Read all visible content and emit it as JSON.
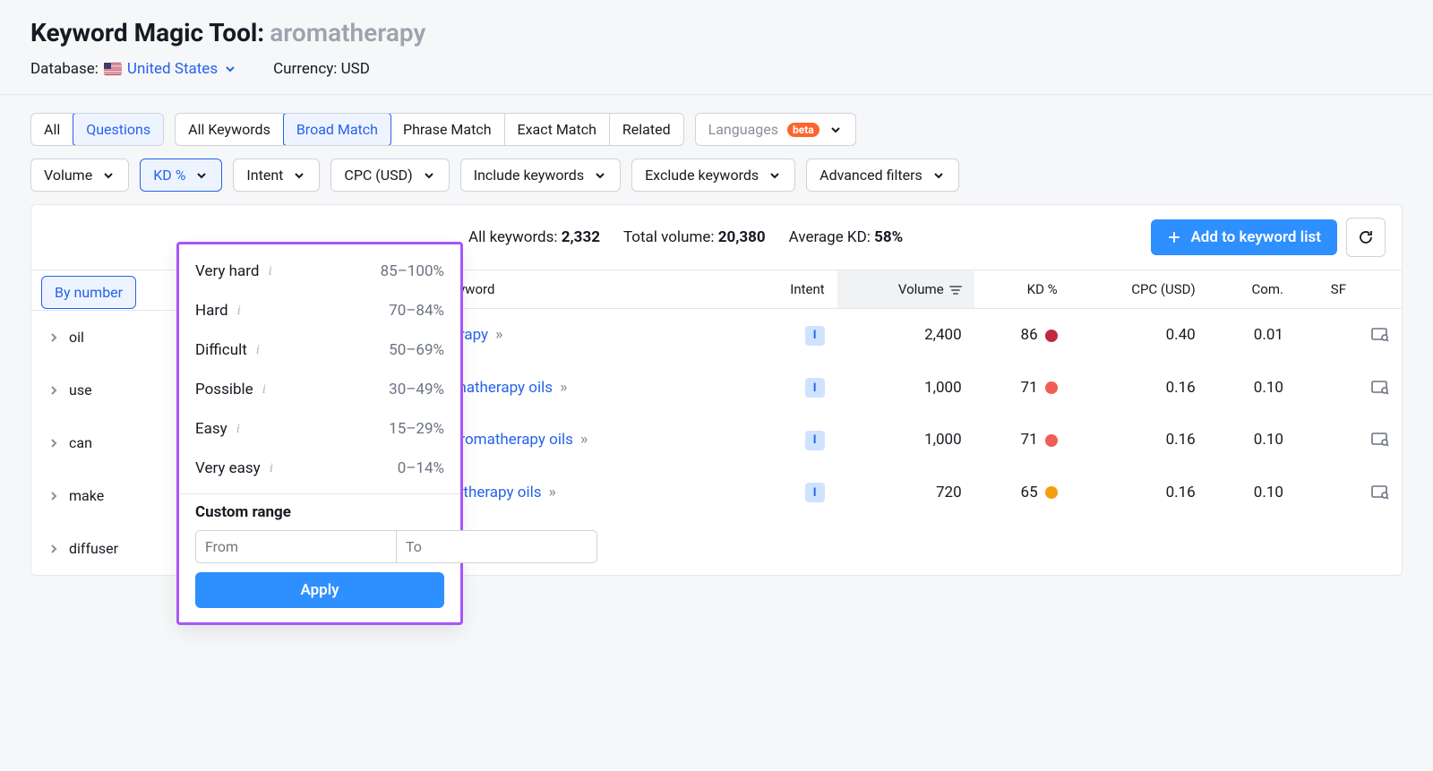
{
  "header": {
    "title_prefix": "Keyword Magic Tool:",
    "query": "aromatherapy",
    "database_label": "Database:",
    "database_value": "United States",
    "currency_label": "Currency:",
    "currency_value": "USD"
  },
  "toggle_group_1": {
    "all": "All",
    "questions": "Questions"
  },
  "match_group": {
    "all_keywords": "All Keywords",
    "broad": "Broad Match",
    "phrase": "Phrase Match",
    "exact": "Exact Match",
    "related": "Related"
  },
  "languages": {
    "label": "Languages",
    "badge": "beta"
  },
  "filters": {
    "volume": "Volume",
    "kd": "KD %",
    "intent": "Intent",
    "cpc": "CPC (USD)",
    "include": "Include keywords",
    "exclude": "Exclude keywords",
    "advanced": "Advanced filters"
  },
  "bynumber": "By number",
  "stats": {
    "keywords_label": "All keywords:",
    "keywords_value": "2,332",
    "volume_label": "Total volume:",
    "volume_value": "20,380",
    "kd_label": "Average KD:",
    "kd_value": "58%"
  },
  "add_button": "Add to keyword list",
  "sidebar": {
    "head": "All keywords",
    "items": [
      "oil",
      "use",
      "can",
      "make",
      "diffuser"
    ]
  },
  "columns": {
    "keyword": "Keyword",
    "intent": "Intent",
    "volume": "Volume",
    "kd": "KD %",
    "cpc": "CPC (USD)",
    "com": "Com.",
    "sf": "SF"
  },
  "rows": [
    {
      "kw": "what is aromatherapy",
      "intent": "I",
      "volume": "2,400",
      "kd": "86",
      "kd_color": "#c0293b",
      "cpc": "0.40",
      "com": "0.01"
    },
    {
      "kw": "how do i use aromatherapy oils",
      "intent": "I",
      "volume": "1,000",
      "kd": "71",
      "kd_color": "#ef5f55",
      "cpc": "0.16",
      "com": "0.10"
    },
    {
      "kw": "how do you use aromatherapy oils",
      "intent": "I",
      "volume": "1,000",
      "kd": "71",
      "kd_color": "#ef5f55",
      "cpc": "0.16",
      "com": "0.10"
    },
    {
      "kw": "how to use aromatherapy oils",
      "intent": "I",
      "volume": "720",
      "kd": "65",
      "kd_color": "#f59e0b",
      "cpc": "0.16",
      "com": "0.10"
    }
  ],
  "kd_menu": {
    "opts": [
      {
        "label": "Very hard",
        "range": "85–100%"
      },
      {
        "label": "Hard",
        "range": "70–84%"
      },
      {
        "label": "Difficult",
        "range": "50–69%"
      },
      {
        "label": "Possible",
        "range": "30–49%"
      },
      {
        "label": "Easy",
        "range": "15–29%"
      },
      {
        "label": "Very easy",
        "range": "0–14%"
      }
    ],
    "custom_title": "Custom range",
    "from_ph": "From",
    "to_ph": "To",
    "apply": "Apply"
  }
}
